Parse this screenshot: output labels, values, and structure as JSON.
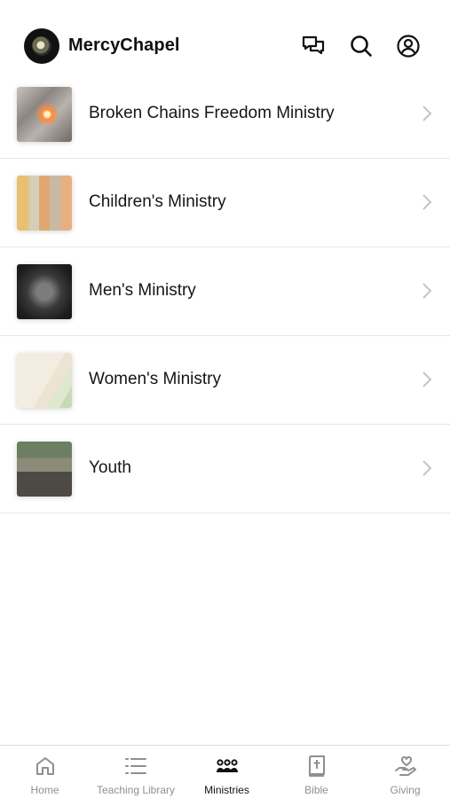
{
  "header": {
    "brand": "MercyChapel",
    "icons": [
      "chat-icon",
      "search-icon",
      "account-icon"
    ]
  },
  "ministries": [
    {
      "label": "Broken Chains Freedom Ministry"
    },
    {
      "label": "Children's Ministry"
    },
    {
      "label": "Men's Ministry"
    },
    {
      "label": "Women's Ministry"
    },
    {
      "label": "Youth"
    }
  ],
  "tabs": [
    {
      "label": "Home",
      "icon": "home-icon",
      "active": false
    },
    {
      "label": "Teaching Library",
      "icon": "list-icon",
      "active": false
    },
    {
      "label": "Ministries",
      "icon": "people-icon",
      "active": true
    },
    {
      "label": "Bible",
      "icon": "bible-icon",
      "active": false
    },
    {
      "label": "Giving",
      "icon": "giving-icon",
      "active": false
    }
  ],
  "colors": {
    "active": "#111111",
    "inactive": "#8f8f8f",
    "divider": "#e6e6e6"
  }
}
